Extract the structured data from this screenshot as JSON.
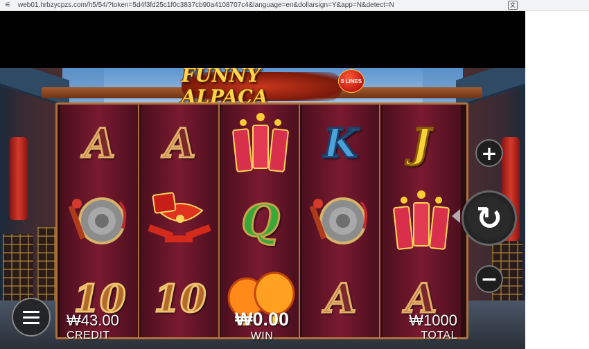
{
  "browser": {
    "url": "web01.hrbzycpzs.com/h5/54/?token=5d4f3fd25c1f0c3837cb90a4108707c4&language=en&dollarsign=Y&app=N&detect=N",
    "site_icon": "tune-icon",
    "translate_icon": "translate-icon"
  },
  "game": {
    "title": "FUNNY ALPACA",
    "lines_badge": "5 LINES",
    "reels": [
      [
        {
          "type": "letter",
          "value": "A",
          "style": "a"
        },
        {
          "type": "icon",
          "icon": "gong-icon"
        },
        {
          "type": "letter",
          "value": "10",
          "style": "10"
        }
      ],
      [
        {
          "type": "letter",
          "value": "A",
          "style": "a"
        },
        {
          "type": "icon",
          "icon": "firecracker-knot-icon"
        },
        {
          "type": "letter",
          "value": "10",
          "style": "10"
        }
      ],
      [
        {
          "type": "icon",
          "icon": "firecrackers-icon"
        },
        {
          "type": "letter",
          "value": "Q",
          "style": "q"
        },
        {
          "type": "icon",
          "icon": "lanterns-icon"
        }
      ],
      [
        {
          "type": "letter",
          "value": "K",
          "style": "k"
        },
        {
          "type": "icon",
          "icon": "gong-icon"
        },
        {
          "type": "letter",
          "value": "A",
          "style": "a"
        }
      ],
      [
        {
          "type": "letter",
          "value": "J",
          "style": "j"
        },
        {
          "type": "icon",
          "icon": "firecrackers-icon"
        },
        {
          "type": "letter",
          "value": "A",
          "style": "a"
        }
      ]
    ],
    "controls": {
      "plus": "+",
      "minus": "−",
      "spin": "↻"
    },
    "credit": {
      "value": "₩43.00",
      "label": "CREDIT"
    },
    "win": {
      "value": "₩0.00",
      "label": "WIN"
    },
    "total": {
      "value": "₩1000",
      "label": "TOTAL"
    }
  }
}
